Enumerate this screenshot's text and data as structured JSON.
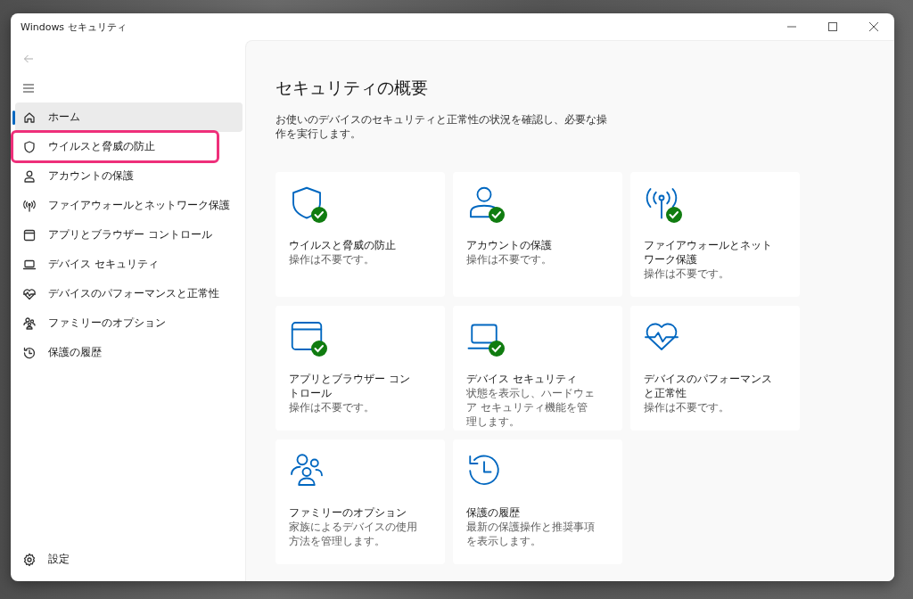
{
  "window": {
    "title": "Windows セキュリティ"
  },
  "sidebar": {
    "items": [
      {
        "label": "ホーム",
        "selected": true,
        "highlighted": false
      },
      {
        "label": "ウイルスと脅威の防止",
        "selected": false,
        "highlighted": true
      },
      {
        "label": "アカウントの保護",
        "selected": false,
        "highlighted": false
      },
      {
        "label": "ファイアウォールとネットワーク保護",
        "selected": false,
        "highlighted": false
      },
      {
        "label": "アプリとブラウザー コントロール",
        "selected": false,
        "highlighted": false
      },
      {
        "label": "デバイス セキュリティ",
        "selected": false,
        "highlighted": false
      },
      {
        "label": "デバイスのパフォーマンスと正常性",
        "selected": false,
        "highlighted": false
      },
      {
        "label": "ファミリーのオプション",
        "selected": false,
        "highlighted": false
      },
      {
        "label": "保護の履歴",
        "selected": false,
        "highlighted": false
      }
    ],
    "settings": {
      "label": "設定"
    }
  },
  "main": {
    "title": "セキュリティの概要",
    "description": "お使いのデバイスのセキュリティと正常性の状況を確認し、必要な操作を実行します。",
    "cards": [
      {
        "title": "ウイルスと脅威の防止",
        "status": "操作は不要です。",
        "checked": true
      },
      {
        "title": "アカウントの保護",
        "status": "操作は不要です。",
        "checked": true
      },
      {
        "title": "ファイアウォールとネットワーク保護",
        "status": "操作は不要です。",
        "checked": true
      },
      {
        "title": "アプリとブラウザー コントロール",
        "status": "操作は不要です。",
        "checked": true
      },
      {
        "title": "デバイス セキュリティ",
        "status": "状態を表示し、ハードウェア セキュリティ機能を管理します。",
        "checked": true
      },
      {
        "title": "デバイスのパフォーマンスと正常性",
        "status": "操作は不要です。",
        "checked": false
      },
      {
        "title": "ファミリーのオプション",
        "status": "家族によるデバイスの使用方法を管理します。",
        "checked": false
      },
      {
        "title": "保護の履歴",
        "status": "最新の保護操作と推奨事項を表示します。",
        "checked": false
      }
    ]
  }
}
